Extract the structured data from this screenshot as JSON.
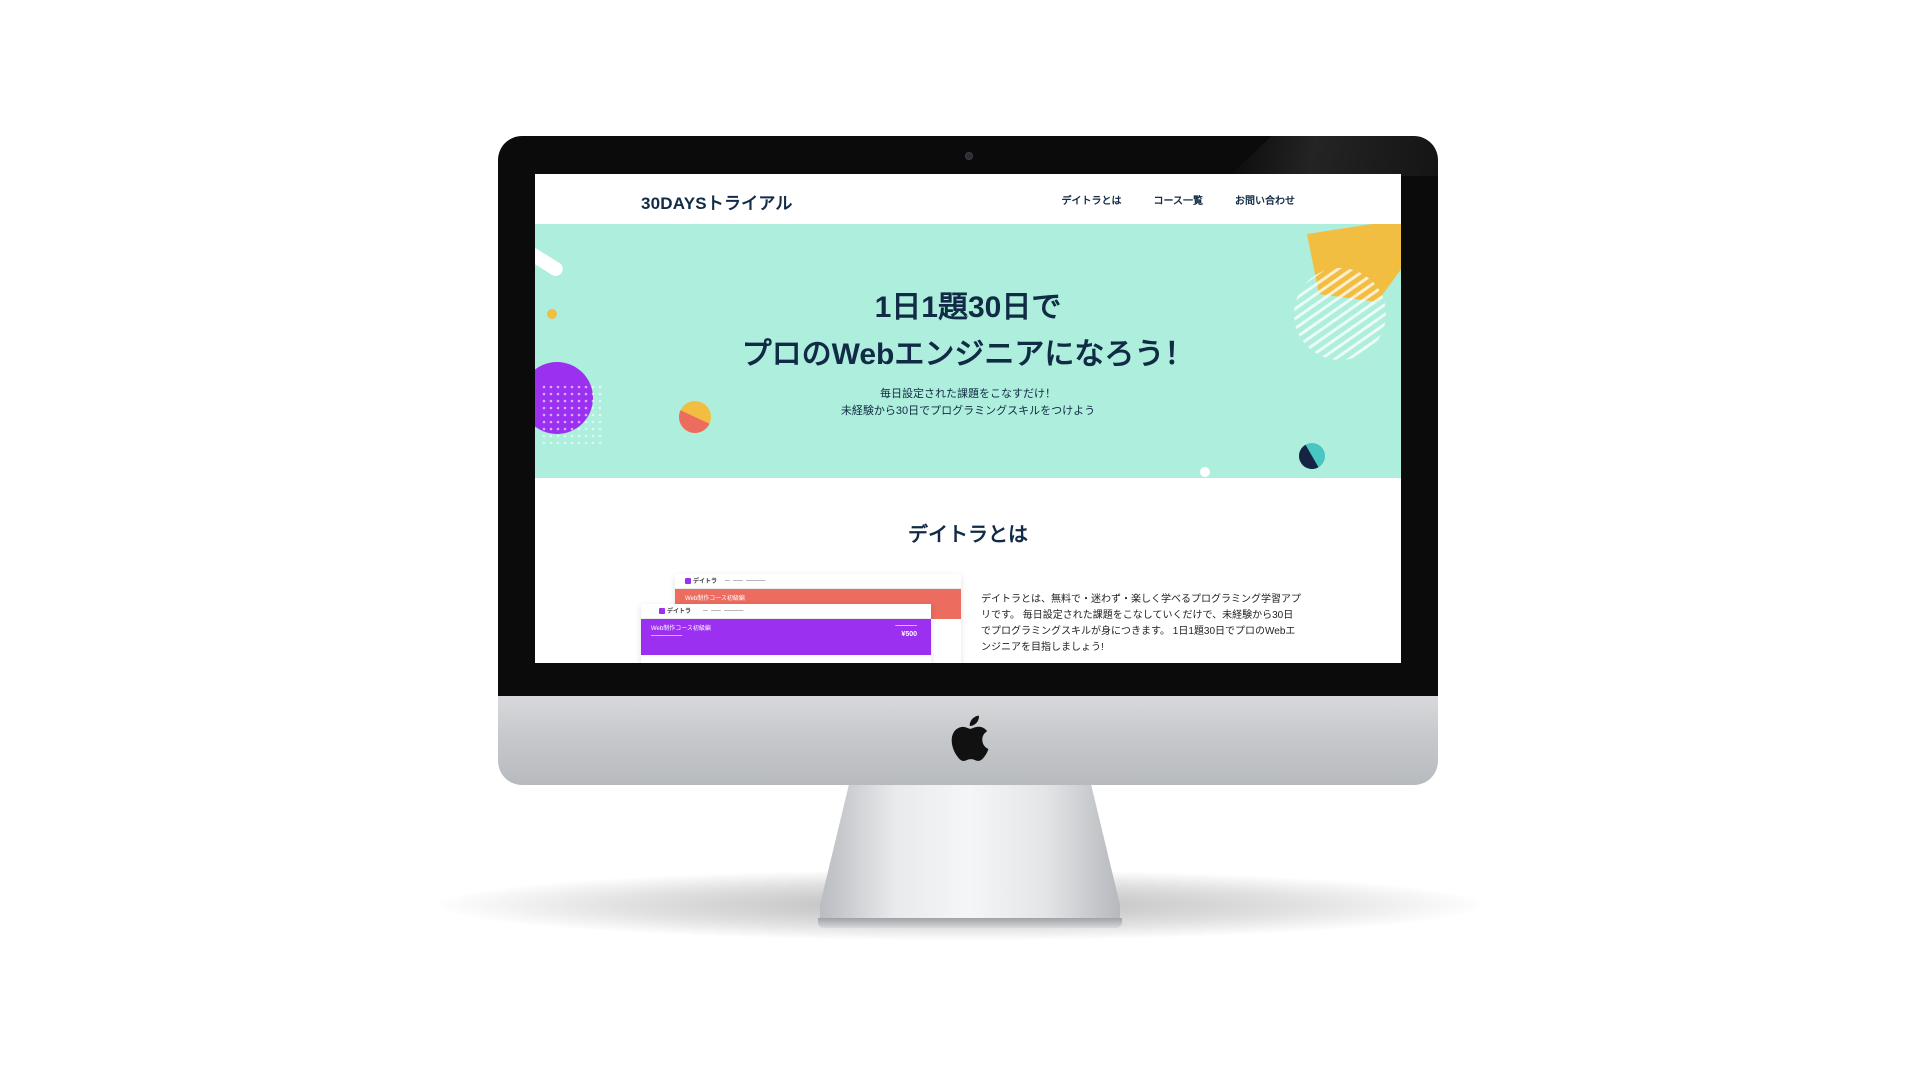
{
  "site": {
    "logo": "30DAYSトライアル",
    "nav": [
      {
        "label": "デイトラとは"
      },
      {
        "label": "コース一覧"
      },
      {
        "label": "お問い合わせ"
      }
    ]
  },
  "hero": {
    "title_line1": "1日1題30日で",
    "title_line2": "プロのWebエンジニアになろう！",
    "sub_line1": "毎日設定された課題をこなすだけ！",
    "sub_line2": "未経験から30日でプログラミングスキルをつけよう"
  },
  "about": {
    "title": "デイトラとは",
    "text": "デイトラとは、無料で・迷わず・楽しく学べるプログラミング学習アプリです。 毎日設定された課題をこなしていくだけで、未経験から30日でプログラミングスキルが身につきます。 1日1題30日でプロのWebエンジニアを目指しましょう!"
  },
  "preview": {
    "brand": "デイトラ",
    "banner_title": "Web制作コース初級編",
    "price": "¥500"
  },
  "colors": {
    "hero_bg": "#aeeedc",
    "text_dark": "#112a45",
    "purple": "#9b30f0",
    "coral": "#ec6c5f",
    "yellow": "#f2be42",
    "bezel": "#0b0b0c"
  }
}
